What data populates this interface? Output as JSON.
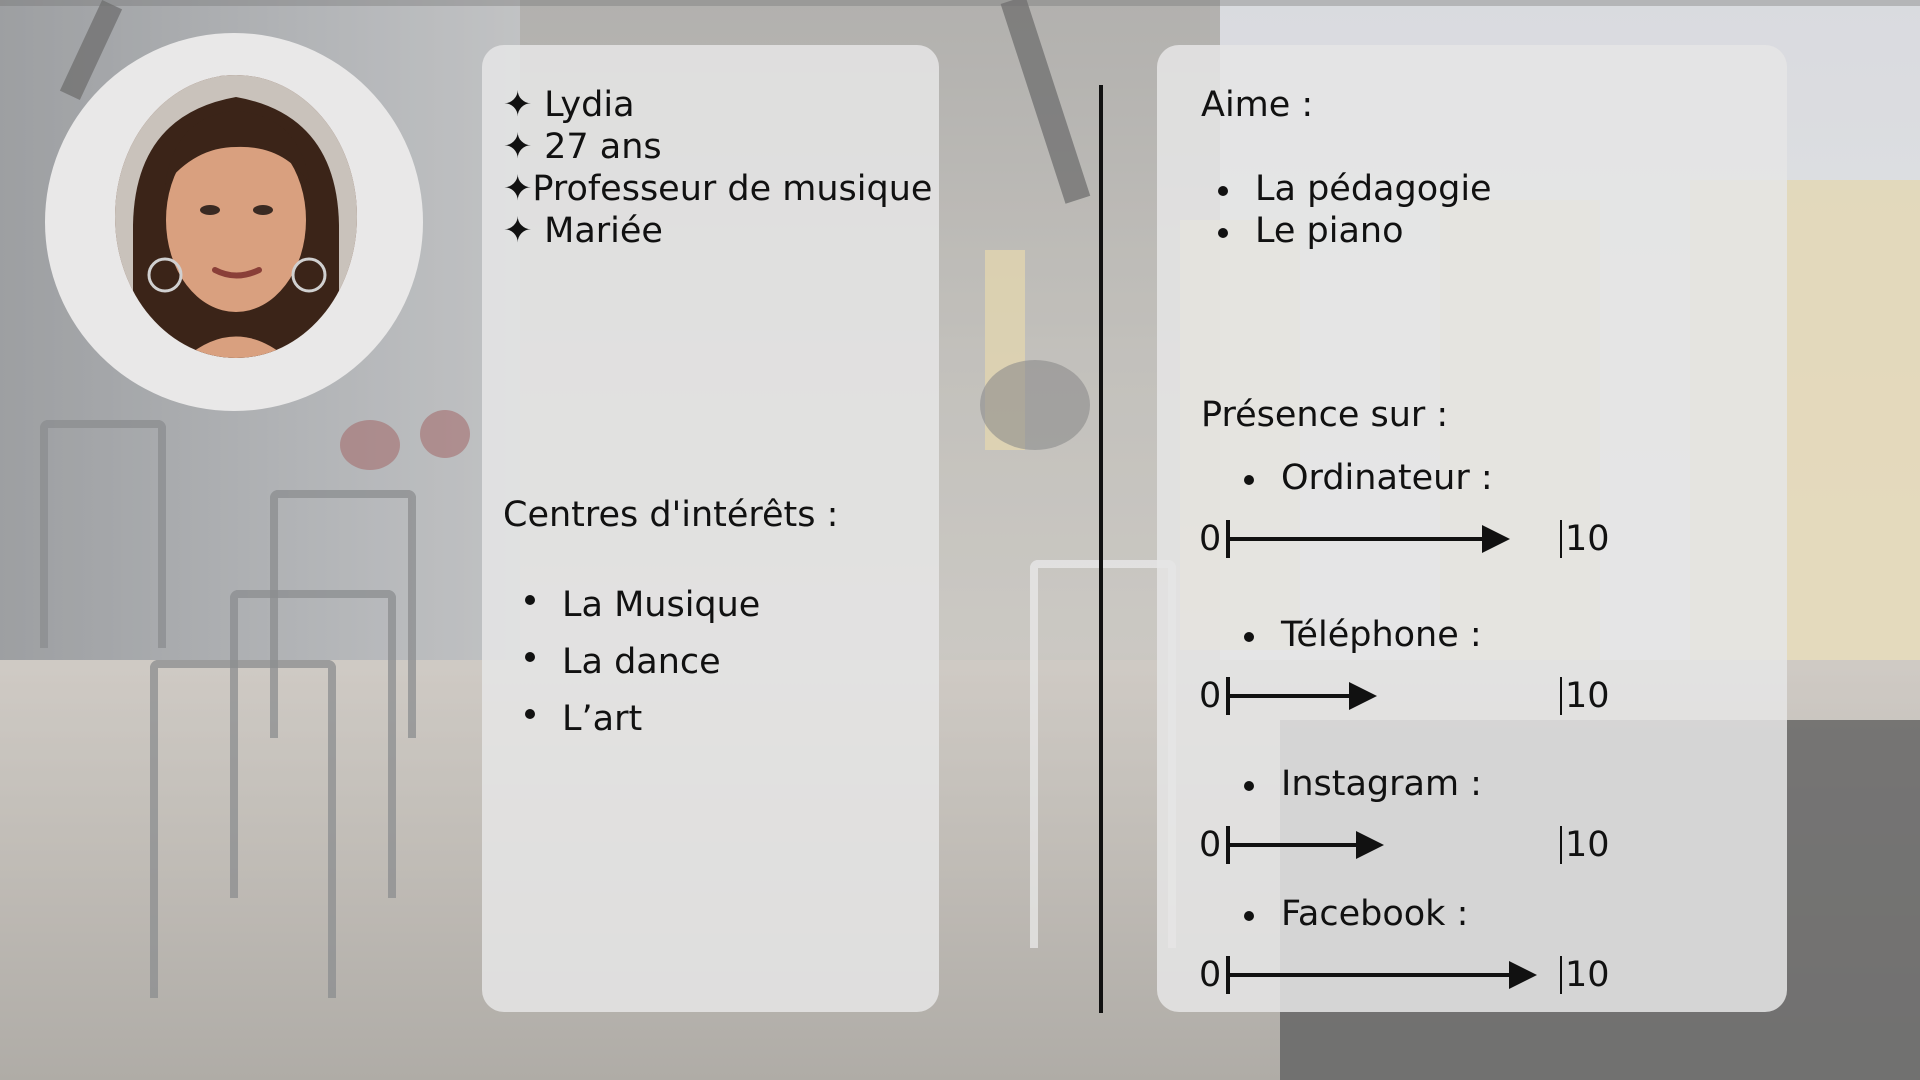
{
  "profile": {
    "name": "Lydia",
    "age": "27 ans",
    "job": "Professeur de musique",
    "status": "Mariée",
    "bullet_glyph": "✦"
  },
  "interests": {
    "title": "Centres d'intérêts :",
    "items": [
      "La Musique",
      "La dance",
      "L’art"
    ]
  },
  "likes": {
    "title": "Aime :",
    "items": [
      "La pédagogie",
      "Le piano"
    ]
  },
  "presence": {
    "title": "Présence sur :",
    "min_label": "0",
    "max_label": "10",
    "items": [
      {
        "label": "Ordinateur :",
        "value": 8.5
      },
      {
        "label": "Téléphone :",
        "value": 4.5
      },
      {
        "label": "Instagram :",
        "value": 4.7
      },
      {
        "label": "Facebook :",
        "value": 9.3
      }
    ]
  },
  "icons": {
    "profile_photo": "woman-portrait-icon",
    "bullet": "four-pointed-star-icon"
  },
  "colors": {
    "card": "#e5e5e5",
    "text": "#111111",
    "avatar_ring": "#e9e8e8"
  }
}
